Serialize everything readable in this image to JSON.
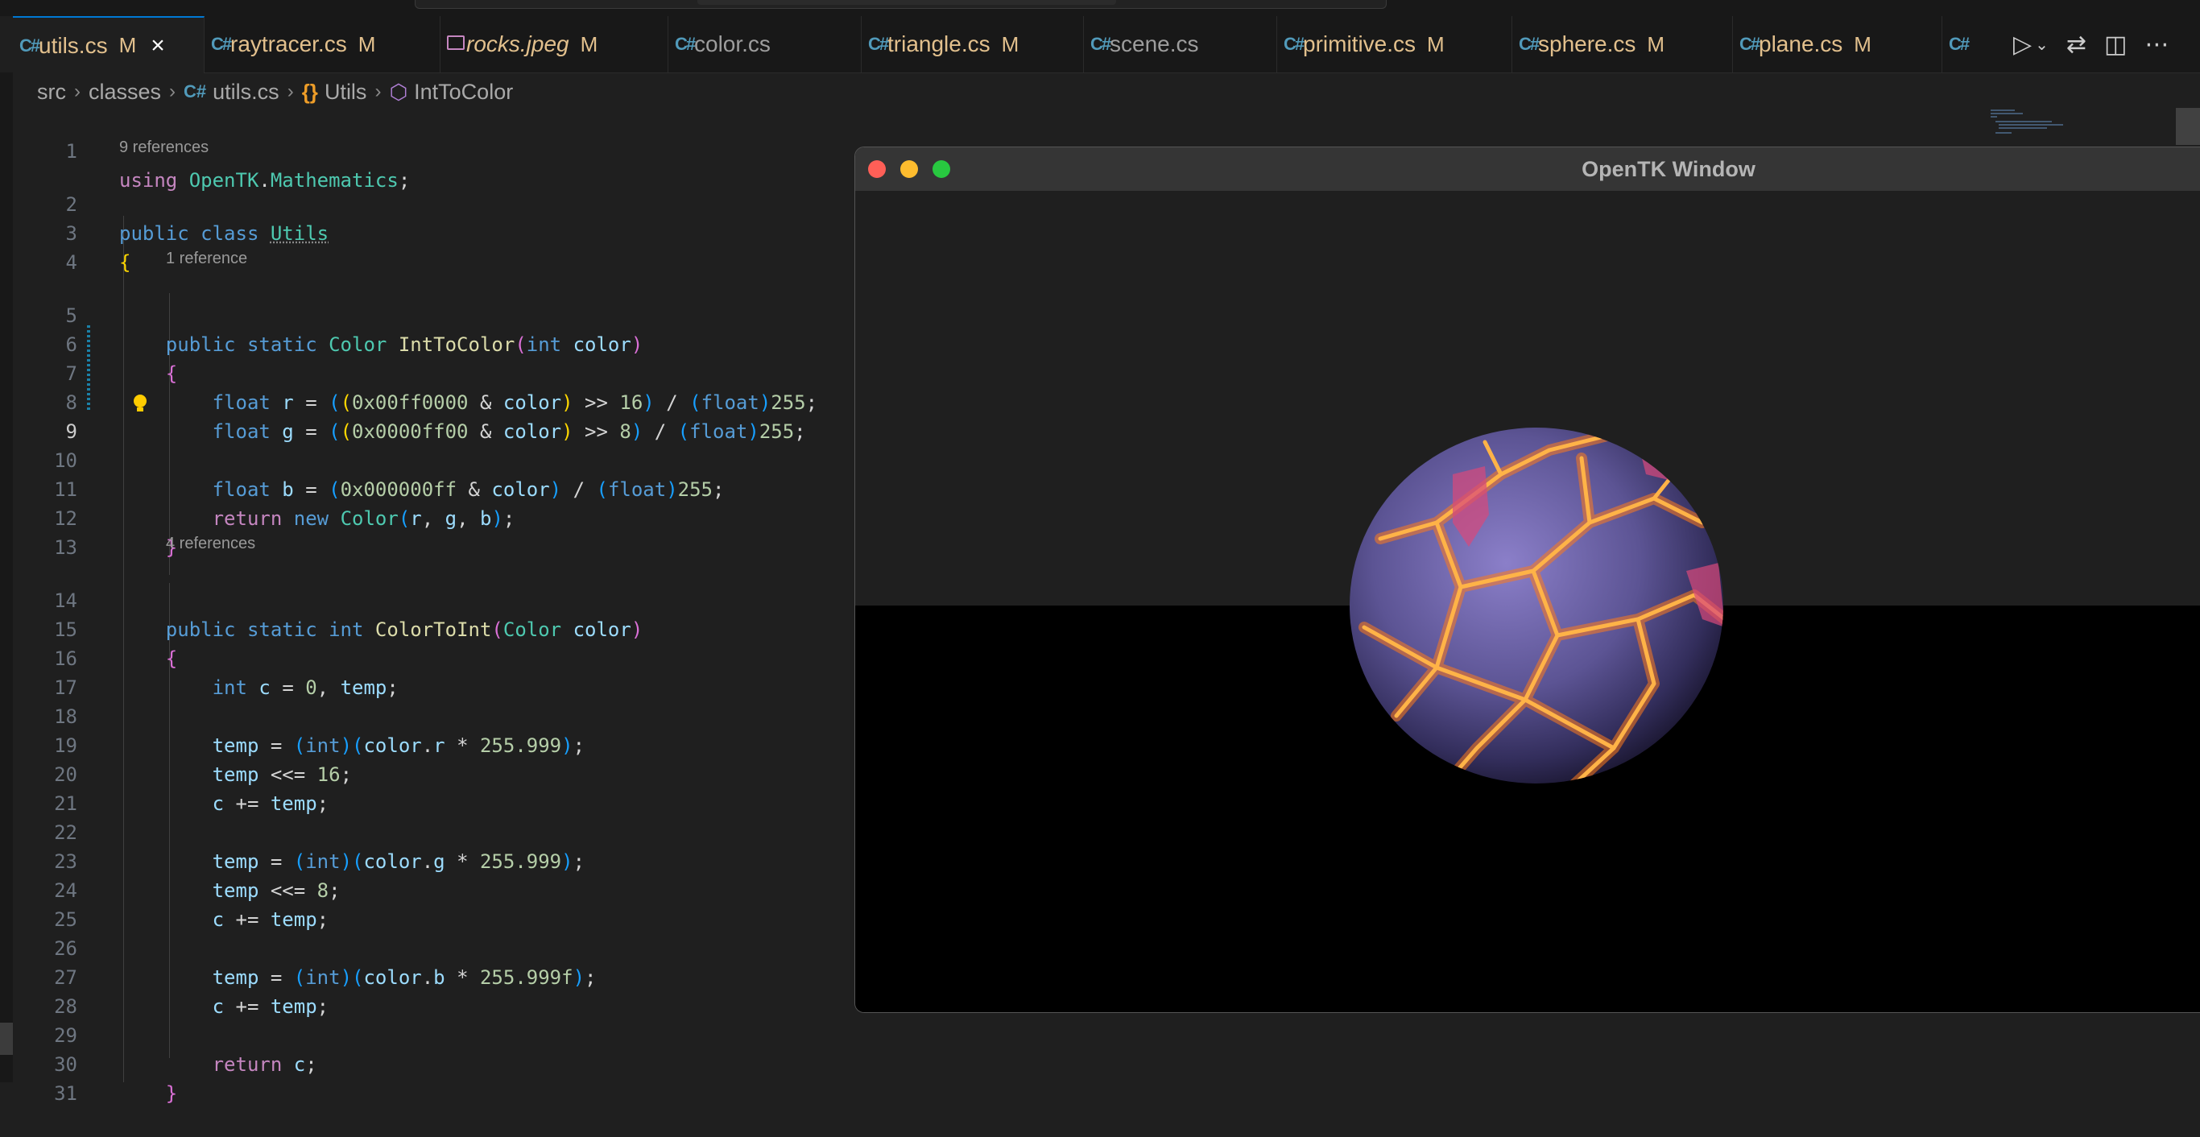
{
  "tabs": [
    {
      "name": "utils.cs",
      "badge": "M",
      "active": true,
      "close": "×"
    },
    {
      "name": "raytracer.cs",
      "badge": "M"
    },
    {
      "name": "rocks.jpeg",
      "badge": "M"
    },
    {
      "name": "color.cs",
      "badge": ""
    },
    {
      "name": "triangle.cs",
      "badge": "M"
    },
    {
      "name": "scene.cs",
      "badge": ""
    },
    {
      "name": "primitive.cs",
      "badge": "M"
    },
    {
      "name": "sphere.cs",
      "badge": "M"
    },
    {
      "name": "plane.cs",
      "badge": "M"
    }
  ],
  "tab_icons": [
    "run-icon",
    "compare-icon",
    "split-editor-icon",
    "more-icon"
  ],
  "breadcrumb": {
    "items": [
      "src",
      "classes",
      "utils.cs",
      "Utils",
      "IntToColor"
    ]
  },
  "editor": {
    "line_numbers": [
      "1",
      "2",
      "3",
      "4",
      "5",
      "6",
      "7",
      "8",
      "9",
      "10",
      "11",
      "12",
      "13",
      "14",
      "15",
      "16",
      "17",
      "18",
      "19",
      "20",
      "21",
      "22",
      "23",
      "24",
      "25",
      "26",
      "27",
      "28",
      "29",
      "30",
      "31"
    ],
    "current_line": "9",
    "references": {
      "utils": "9 references",
      "int_to_color": "1 reference",
      "color_to_int": "4 references"
    },
    "lines": [
      "using OpenTK.Mathematics;",
      "public class Utils",
      "{",
      "",
      "    public static Color IntToColor(int color)",
      "    {",
      "        float r = ((0x00ff0000 & color) >> 16) / (float)255;",
      "        float g = ((0x0000ff00 & color) >> 8) / (float)255;",
      "        float b = (0x000000ff & color) / (float)255;",
      "",
      "        return new Color(r, g, b);",
      "    }",
      "",
      "    public static int ColorToInt(Color color)",
      "    {",
      "        int c = 0, temp;",
      "",
      "        temp = (int)(color.r * 255.999);",
      "        temp <<= 16;",
      "        c += temp;",
      "",
      "        temp = (int)(color.g * 255.999);",
      "        temp <<= 8;",
      "        c += temp;",
      "",
      "        temp = (int)(color.b * 255.999f);",
      "        c += temp;",
      "",
      "        return c;",
      "    }",
      ""
    ]
  },
  "opentk_window": {
    "title": "OpenTK Window"
  },
  "colors": {
    "accent": "#0078d4",
    "modified": "#e2c08d",
    "background": "#1f1f1f",
    "sky": "#1f1f1f",
    "ground": "#000000"
  }
}
